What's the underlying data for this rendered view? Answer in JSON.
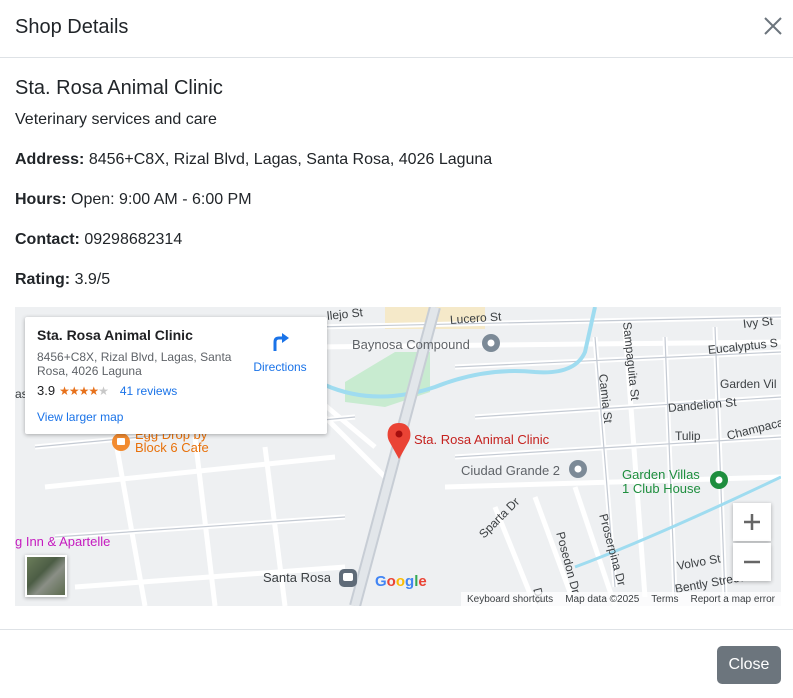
{
  "modal": {
    "title": "Shop Details",
    "close_button": "Close"
  },
  "shop": {
    "name": "Sta. Rosa Animal Clinic",
    "description": "Veterinary services and care",
    "address_label": "Address:",
    "address": "8456+C8X, Rizal Blvd, Lagas, Santa Rosa, 4026 Laguna",
    "hours_label": "Hours:",
    "hours": "Open: 9:00 AM - 6:00 PM",
    "contact_label": "Contact:",
    "contact": "09298682314",
    "rating_label": "Rating:",
    "rating": "3.9/5"
  },
  "map": {
    "info_card": {
      "title": "Sta. Rosa Animal Clinic",
      "address": "8456+C8X, Rizal Blvd, Lagas, Santa Rosa, 4026 Laguna",
      "rating": "3.9",
      "stars": 3.9,
      "reviews": "41 reviews",
      "view_larger": "View larger map",
      "directions": "Directions"
    },
    "marker_label": "Sta. Rosa Animal Clinic",
    "places": {
      "baynosa": "Baynosa Compound",
      "egg_drop": "Egg Drop by\nBlock 6 Cafe",
      "ciudad": "Ciudad Grande 2",
      "garden_villas": "Garden Villas\n1 Club House",
      "inn": "g Inn & Apartelle",
      "santa_rosa": "Santa Rosa"
    },
    "streets": {
      "lucero": "Lucero St",
      "vallejo": "llejo St",
      "sampaguita": "Sampaguita St",
      "ivy": "Ivy St",
      "eucalyptus": "Eucalyptus S",
      "garden_vil": "Garden Vil",
      "camia": "Camia St",
      "dandelion": "Dandelion St",
      "tulip": "Tulip",
      "champaca": "Champaca St",
      "sparta": "Sparta Dr",
      "posedon": "Posedon Dr",
      "proserpina": "Proserpina Dr",
      "volvo": "Volvo St",
      "bentley": "Bently Street",
      "da": "Da",
      "as": "as"
    },
    "google_logo": "Google",
    "footer": {
      "shortcuts": "Keyboard shortcuts",
      "data": "Map data ©2025",
      "terms": "Terms",
      "report": "Report a map error"
    },
    "zoom_in": "+",
    "zoom_out": "−"
  },
  "colors": {
    "brand_blue": "#1a73e8",
    "marker_red": "#ea4335",
    "close_btn": "#6c757d",
    "stars": "#e7711b"
  }
}
